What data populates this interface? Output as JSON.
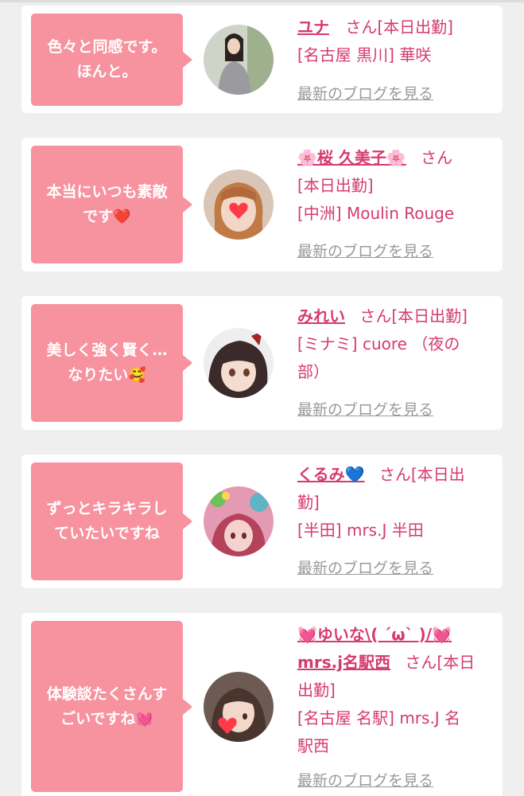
{
  "cards": [
    {
      "bubble_text": "色々と同感です。\nほんと。",
      "name": "ユナ",
      "honorific": "さん[本日出勤]",
      "shop": "[名古屋 黒川] 華咲",
      "blog_link": "最新のブログを見る",
      "avatar_icon": "photo-avatar-woman-grey-top"
    },
    {
      "bubble_text": "本当にいつも素敵\nです",
      "bubble_emoji": "❤️",
      "name": "🌸桜 久美子🌸",
      "honorific": "さん",
      "status": "[本日出勤]",
      "shop": "[中洲] Moulin Rouge",
      "blog_link": "最新のブログを見る",
      "avatar_icon": "photo-avatar-woman-heart-sticker"
    },
    {
      "bubble_text": "美しく強く賢く…\nなりたい",
      "bubble_emoji": "🥰",
      "name": "みれい",
      "honorific": "さん[本日出勤]",
      "shop": "[ミナミ] cuore （夜の\n部）",
      "blog_link": "最新のブログを見る",
      "avatar_icon": "photo-avatar-anime-girl"
    },
    {
      "bubble_text": "ずっとキラキラし\nていたいですね",
      "name": "くるみ💙",
      "honorific": "さん[本日出\n勤]",
      "shop": "[半田] mrs.J 半田",
      "blog_link": "最新のブログを見る",
      "avatar_icon": "photo-avatar-woman-colorful"
    },
    {
      "bubble_text": "体験談たくさんす\nごいですね",
      "bubble_emoji": "💓",
      "name_line1": "💓ゆいな\\( ´ω` )/💓",
      "name_line2": "mrs.j名駅西",
      "honorific": "さん[本日\n出勤]",
      "shop": "[名古屋 名駅] mrs.J 名\n駅西",
      "blog_link": "最新のブログを見る",
      "avatar_icon": "photo-avatar-woman-heart-sticker"
    }
  ],
  "colors": {
    "page_bg": "#efefef",
    "card_bg": "#ffffff",
    "bubble": "#f7929f",
    "accent_text": "#d63a6e",
    "link_grey": "#9a9a9a"
  }
}
